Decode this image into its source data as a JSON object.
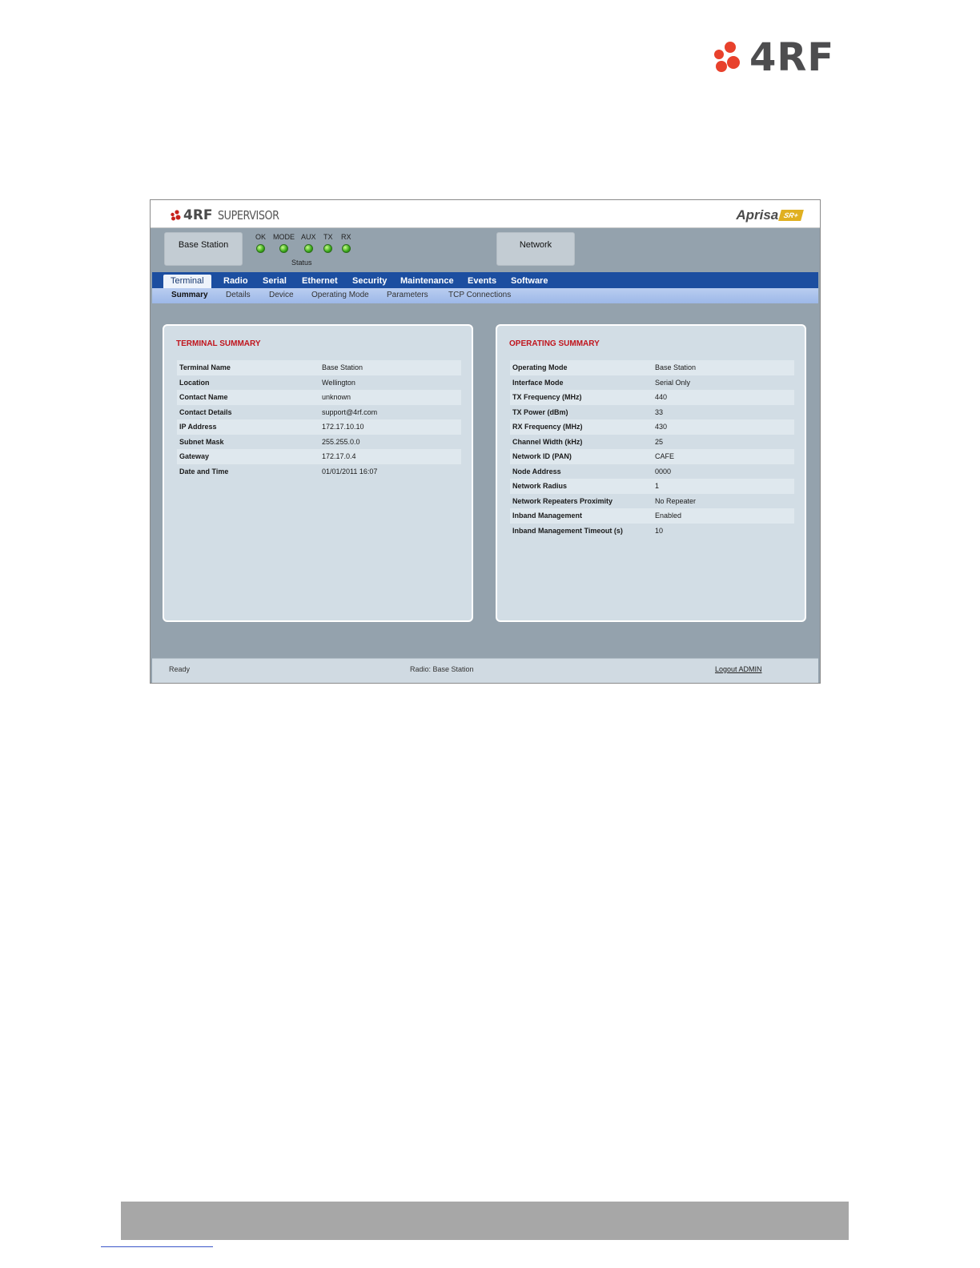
{
  "page": {
    "logo_text": "4RF"
  },
  "app": {
    "header": {
      "brand": "4RF",
      "product": "SUPERVISOR",
      "aprisa_text": "Aprisa",
      "aprisa_badge": "SR+"
    },
    "station": {
      "label": "Base Station"
    },
    "network": {
      "label": "Network"
    },
    "leds": [
      {
        "label": "OK",
        "state": "green"
      },
      {
        "label": "MODE",
        "state": "green"
      },
      {
        "label": "AUX",
        "state": "green"
      },
      {
        "label": "TX",
        "state": "green"
      },
      {
        "label": "RX",
        "state": "green"
      }
    ],
    "leds_caption": "Status",
    "nav_main": [
      "Terminal",
      "Radio",
      "Serial",
      "Ethernet",
      "Security",
      "Maintenance",
      "Events",
      "Software"
    ],
    "nav_main_active": "Terminal",
    "nav_sub": [
      "Summary",
      "Details",
      "Device",
      "Operating Mode",
      "Parameters",
      "TCP Connections"
    ],
    "nav_sub_active": "Summary",
    "terminal_summary": {
      "title": "TERMINAL SUMMARY",
      "rows": [
        {
          "key": "Terminal Name",
          "value": "Base Station"
        },
        {
          "key": "Location",
          "value": "Wellington"
        },
        {
          "key": "Contact Name",
          "value": "unknown"
        },
        {
          "key": "Contact Details",
          "value": "support@4rf.com"
        },
        {
          "key": "IP Address",
          "value": "172.17.10.10"
        },
        {
          "key": "Subnet Mask",
          "value": "255.255.0.0"
        },
        {
          "key": "Gateway",
          "value": "172.17.0.4"
        },
        {
          "key": "Date and Time",
          "value": "01/01/2011 16:07"
        }
      ]
    },
    "operating_summary": {
      "title": "OPERATING SUMMARY",
      "rows": [
        {
          "key": "Operating Mode",
          "value": "Base Station"
        },
        {
          "key": "Interface Mode",
          "value": "Serial Only"
        },
        {
          "key": "TX Frequency (MHz)",
          "value": "440"
        },
        {
          "key": "TX Power (dBm)",
          "value": "33"
        },
        {
          "key": "RX Frequency (MHz)",
          "value": "430"
        },
        {
          "key": "Channel Width (kHz)",
          "value": "25"
        },
        {
          "key": "Network ID (PAN)",
          "value": "CAFE"
        },
        {
          "key": "Node Address",
          "value": "0000"
        },
        {
          "key": "Network Radius",
          "value": "1"
        },
        {
          "key": "Network Repeaters Proximity",
          "value": "No Repeater"
        },
        {
          "key": "Inband Management",
          "value": "Enabled"
        },
        {
          "key": "Inband Management Timeout (s)",
          "value": "10"
        }
      ]
    },
    "footer": {
      "status": "Ready",
      "radio": "Radio: Base Station",
      "logout": "Logout ADMIN"
    }
  },
  "colors": {
    "nav_bar": "#1c4ea0",
    "panel_title": "#c0141c",
    "logo_red": "#e8412c",
    "led_green": "#39a81a"
  }
}
